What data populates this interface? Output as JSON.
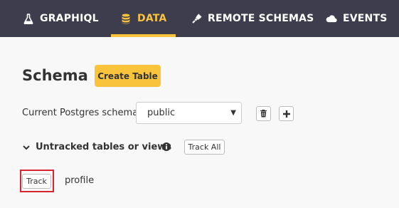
{
  "nav": {
    "tabs": [
      {
        "label": "GRAPHIQL",
        "icon": "flask-icon",
        "active": false
      },
      {
        "label": "DATA",
        "icon": "database-icon",
        "active": true
      },
      {
        "label": "REMOTE SCHEMAS",
        "icon": "plug-icon",
        "active": false
      },
      {
        "label": "EVENTS",
        "icon": "cloud-icon",
        "active": false
      }
    ]
  },
  "page": {
    "title": "Schema",
    "create_table_label": "Create Table"
  },
  "schema": {
    "label": "Current Postgres schema",
    "selected": "public",
    "delete_icon": "trash-icon",
    "add_icon": "plus-icon"
  },
  "untracked": {
    "heading": "Untracked tables or views",
    "track_all_label": "Track All",
    "items": [
      {
        "track_label": "Track",
        "name": "profile"
      }
    ]
  },
  "colors": {
    "nav_bg": "#3d3d4e",
    "accent": "#f9c43c",
    "highlight": "#d9232e"
  }
}
